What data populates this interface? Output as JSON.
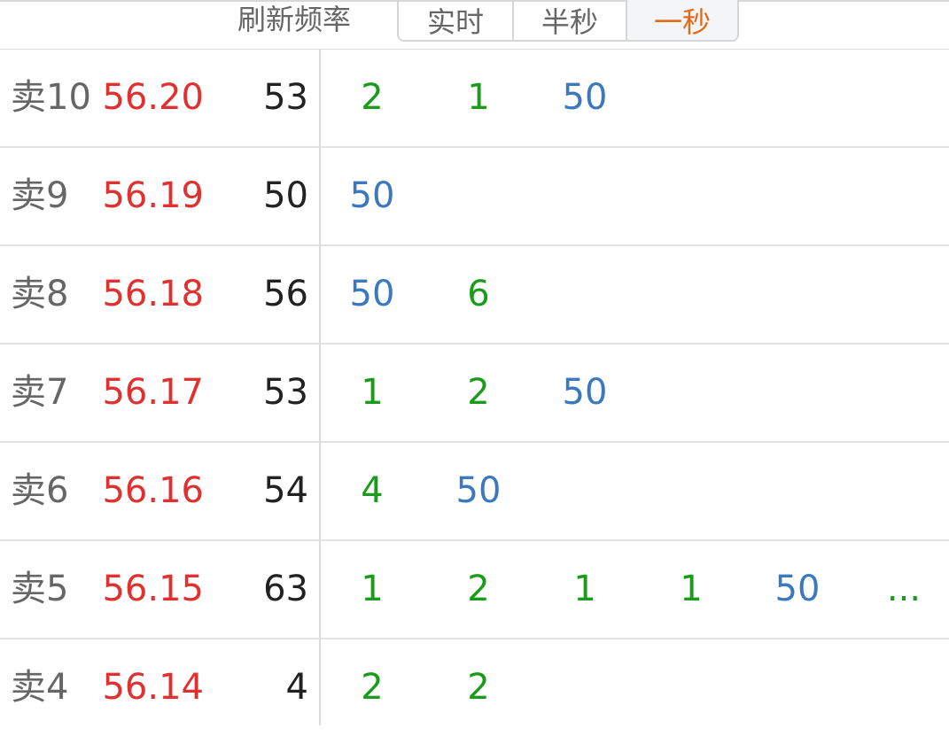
{
  "header": {
    "label": "刷新频率",
    "options": [
      "实时",
      "半秒",
      "一秒"
    ],
    "active_index": 2
  },
  "colors": {
    "price": "#e03131",
    "small_order": "#1a9c1a",
    "large_order": "#3b78c0",
    "active_option": "#e06a1b"
  },
  "rows": [
    {
      "label": "卖10",
      "price": "56.20",
      "volume": "53",
      "ticks": [
        {
          "v": "2",
          "c": "green"
        },
        {
          "v": "1",
          "c": "green"
        },
        {
          "v": "50",
          "c": "blue"
        }
      ]
    },
    {
      "label": "卖9",
      "price": "56.19",
      "volume": "50",
      "ticks": [
        {
          "v": "50",
          "c": "blue"
        }
      ]
    },
    {
      "label": "卖8",
      "price": "56.18",
      "volume": "56",
      "ticks": [
        {
          "v": "50",
          "c": "blue"
        },
        {
          "v": "6",
          "c": "green"
        }
      ]
    },
    {
      "label": "卖7",
      "price": "56.17",
      "volume": "53",
      "ticks": [
        {
          "v": "1",
          "c": "green"
        },
        {
          "v": "2",
          "c": "green"
        },
        {
          "v": "50",
          "c": "blue"
        }
      ]
    },
    {
      "label": "卖6",
      "price": "56.16",
      "volume": "54",
      "ticks": [
        {
          "v": "4",
          "c": "green"
        },
        {
          "v": "50",
          "c": "blue"
        }
      ]
    },
    {
      "label": "卖5",
      "price": "56.15",
      "volume": "63",
      "ticks": [
        {
          "v": "1",
          "c": "green"
        },
        {
          "v": "2",
          "c": "green"
        },
        {
          "v": "1",
          "c": "green"
        },
        {
          "v": "1",
          "c": "green"
        },
        {
          "v": "50",
          "c": "blue"
        },
        {
          "v": "...",
          "c": "green"
        }
      ]
    },
    {
      "label": "卖4",
      "price": "56.14",
      "volume": "4",
      "ticks": [
        {
          "v": "2",
          "c": "green"
        },
        {
          "v": "2",
          "c": "green"
        }
      ]
    }
  ]
}
